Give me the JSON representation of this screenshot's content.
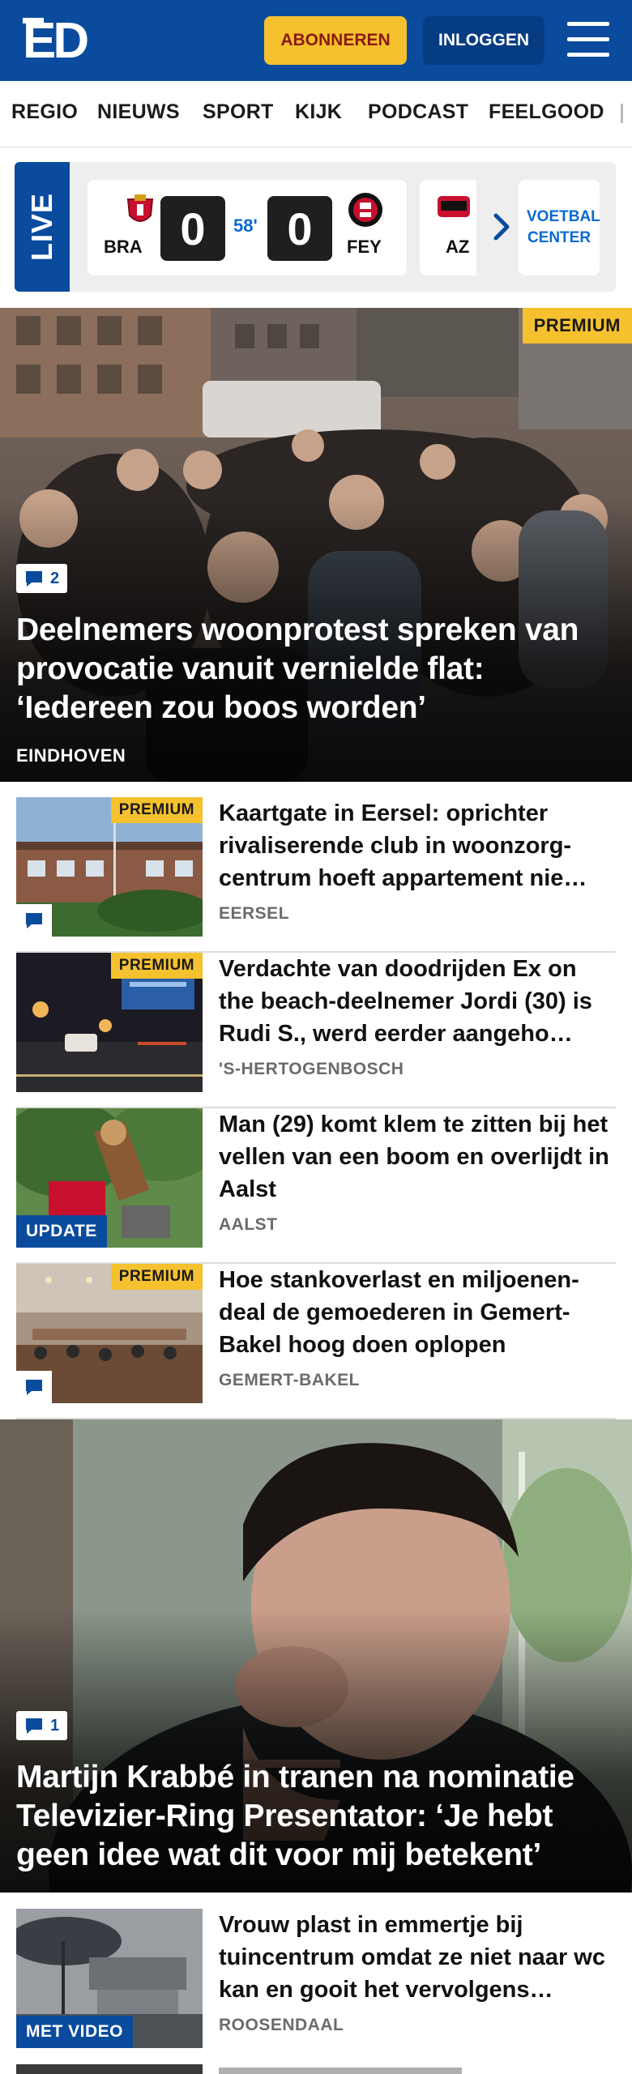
{
  "header": {
    "logo_text": "ED",
    "subscribe_label": "ABONNEREN",
    "login_label": "INLOGGEN",
    "brand_color": "#0a4b9e",
    "accent_color": "#f5c12e"
  },
  "nav": {
    "items": [
      "REGIO",
      "NIEUWS",
      "SPORT",
      "KIJK",
      "PODCAST",
      "FEELGOOD"
    ]
  },
  "live": {
    "label": "LIVE",
    "match": {
      "home_code": "BRA",
      "away_code": "FEY",
      "home_score": "0",
      "away_score": "0",
      "minute": "58'"
    },
    "next_match_code": "AZ",
    "voetbal_center_label": "VOETBAL CENTER"
  },
  "hero1": {
    "premium_label": "PREMIUM",
    "comments": "2",
    "title": "Deelnemers woonprotest spreken van provocatie vanuit vernielde flat: ‘Iedereen zou boos worden’",
    "location": "EINDHOVEN"
  },
  "articles": [
    {
      "title": "Kaartgate in Eersel: oprichter rivaliserende club in woonzorg-centrum hoeft appartement nie…",
      "location": "EERSEL",
      "premium_label": "PREMIUM"
    },
    {
      "title": "Verdachte van doodrijden Ex on the beach-deelnemer Jordi (30) is Rudi S., werd eerder aangeho…",
      "location": "'S-HERTOGENBOSCH",
      "premium_label": "PREMIUM"
    },
    {
      "title": "Man (29) komt klem te zitten bij het vellen van een boom en overlijdt in Aalst",
      "location": "AALST",
      "update_label": "UPDATE"
    },
    {
      "title": "Hoe stankoverlast en miljoenen-deal de gemoederen in Gemert-Bakel hoog doen oplopen",
      "location": "GEMERT-BAKEL",
      "premium_label": "PREMIUM"
    }
  ],
  "hero2": {
    "comments": "1",
    "title": "Martijn Krabbé in tranen na nominatie Televizier-Ring Presentator: ‘Je hebt geen idee wat dit voor mij betekent’"
  },
  "article5": {
    "title": "Vrouw plast in emmertje bij tuincentrum omdat ze niet naar wc kan en gooit het vervolgens…",
    "location": "ROOSENDAAL",
    "video_label": "MET VIDEO"
  }
}
